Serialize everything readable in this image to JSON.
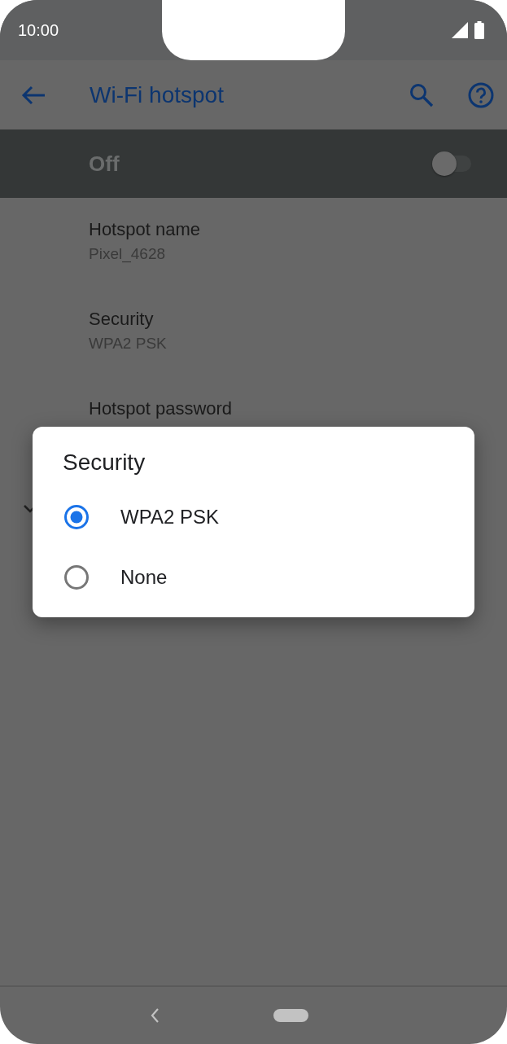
{
  "status_bar": {
    "time": "10:00"
  },
  "app_bar": {
    "title": "Wi-Fi hotspot"
  },
  "master_switch": {
    "label": "Off",
    "on": false
  },
  "settings": [
    {
      "title": "Hotspot name",
      "summary": "Pixel_4628"
    },
    {
      "title": "Security",
      "summary": "WPA2 PSK"
    },
    {
      "title": "Hotspot password"
    }
  ],
  "dialog": {
    "title": "Security",
    "options": [
      {
        "label": "WPA2 PSK",
        "selected": true
      },
      {
        "label": "None",
        "selected": false
      }
    ]
  }
}
